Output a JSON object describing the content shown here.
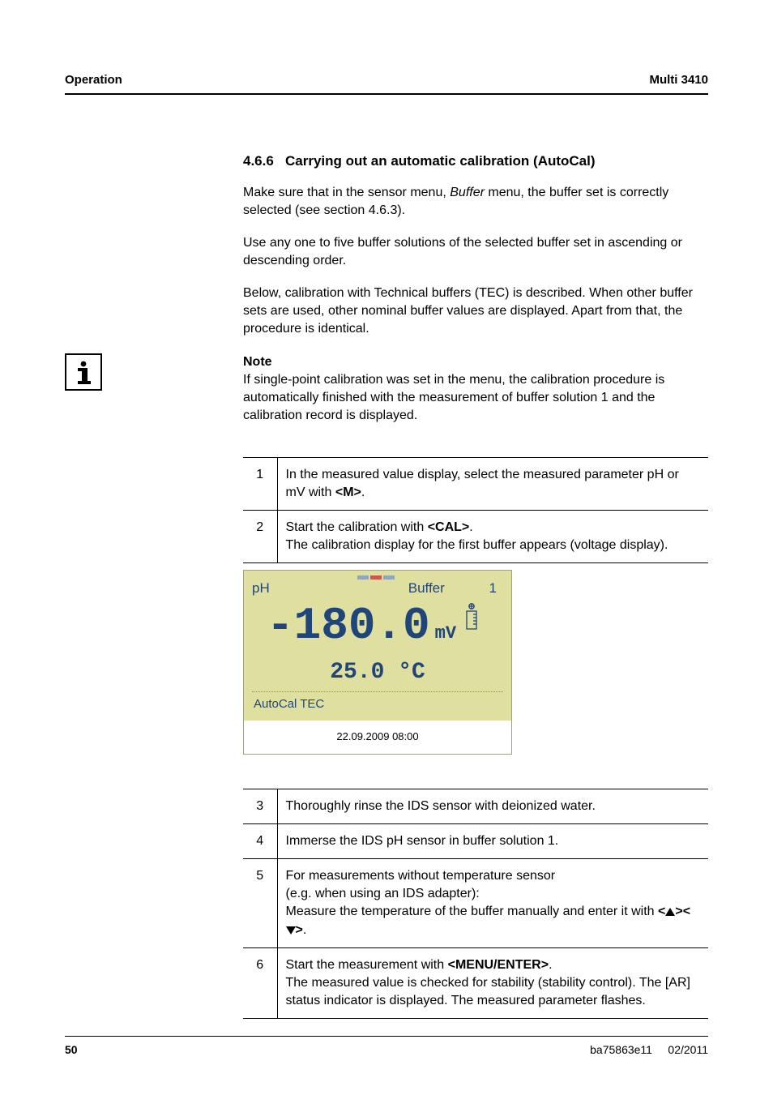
{
  "header": {
    "left": "Operation",
    "right": "Multi 3410"
  },
  "section": {
    "number": "4.6.6",
    "title": "Carrying out an automatic calibration (AutoCal)"
  },
  "paras": {
    "p1a": "Make sure that in the sensor menu, ",
    "p1b": "Buffer",
    "p1c": " menu, the buffer set is correctly selected (see section 4.6.3).",
    "p2": "Use any one to five buffer solutions of the selected buffer set in ascending or descending order.",
    "p3": "Below, calibration with Technical buffers (TEC) is described. When other buffer sets are used, other nominal buffer values are displayed. Apart from that, the procedure is identical."
  },
  "note": {
    "title": "Note",
    "body": "If single-point calibration was set in the menu, the calibration procedure is automatically finished with the measurement of buffer solution 1 and the calibration record is displayed."
  },
  "steps_a": [
    {
      "n": "1",
      "pre": "In the measured value display, select the measured parameter pH or mV with ",
      "k1": "<M>",
      "post": "."
    },
    {
      "n": "2",
      "pre": "Start the calibration with ",
      "k1": "<CAL>",
      "post": ".\nThe calibration display for the first buffer appears (voltage display)."
    }
  ],
  "lcd": {
    "ph_label": "pH",
    "buffer_label": "Buffer",
    "buffer_num": "1",
    "value": "-180.0",
    "unit": "mV",
    "temp": "25.0 °C",
    "status": "AutoCal TEC",
    "timestamp": "22.09.2009 08:00"
  },
  "steps_b": [
    {
      "n": "3",
      "text": "Thoroughly rinse the IDS sensor with deionized water."
    },
    {
      "n": "4",
      "text": "Immerse the IDS pH sensor in buffer solution 1."
    },
    {
      "n": "5",
      "l1": "For measurements without temperature sensor",
      "l2": "(e.g. when using an IDS adapter):",
      "l3": "Measure the temperature of the buffer manually and enter it with ",
      "k_open": "<",
      "k_mid": "><",
      "k_close": ">",
      "l3b": "."
    },
    {
      "n": "6",
      "pre": "Start the measurement with ",
      "k1": "<MENU/ENTER>",
      "post": ".\nThe measured value is checked for stability (stability control). The [AR] status indicator is displayed. The measured parameter flashes."
    }
  ],
  "footer": {
    "page": "50",
    "doc": "ba75863e11",
    "date": "02/2011"
  }
}
